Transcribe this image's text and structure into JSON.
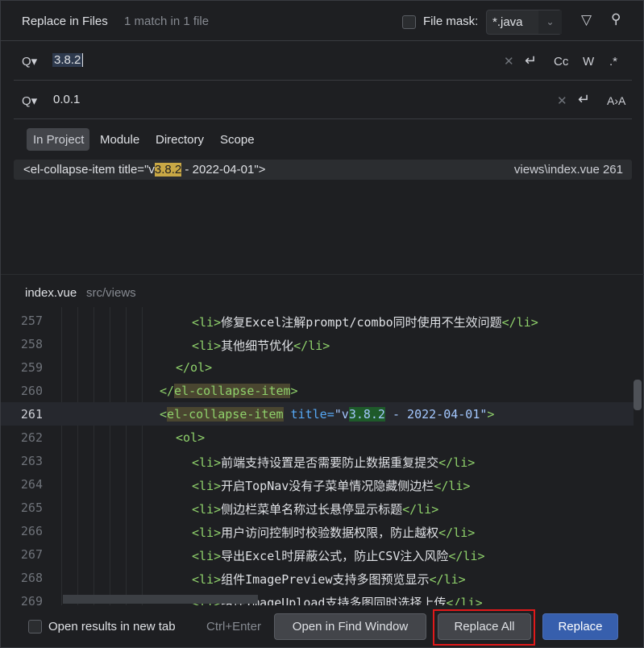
{
  "header": {
    "title": "Replace in Files",
    "match_count": "1 match in 1 file",
    "file_mask_label": "File mask:",
    "file_mask_checked": false,
    "file_mask_value": "*.java"
  },
  "search": {
    "value": "3.8.2",
    "options": {
      "case": "Cc",
      "words": "W",
      "regex": ".*"
    }
  },
  "replace": {
    "value": "0.0.1"
  },
  "scopes": [
    {
      "label": "In Project",
      "active": true
    },
    {
      "label": "Module"
    },
    {
      "label": "Directory"
    },
    {
      "label": "Scope"
    }
  ],
  "result": {
    "prefix": "<el-collapse-item title=\"v",
    "match": "3.8.2",
    "suffix": " - 2022-04-01\">",
    "location": "views\\index.vue 261"
  },
  "preview": {
    "file": "index.vue",
    "path": "src/views",
    "lines": [
      {
        "n": "257",
        "indent": "li",
        "text": "修复Excel注解prompt/combo同时使用不生效问题"
      },
      {
        "n": "258",
        "indent": "li",
        "text": "其他细节优化"
      },
      {
        "n": "259",
        "indent": "ol",
        "text": "</ol>"
      },
      {
        "n": "260",
        "indent": "item",
        "text": "</el-collapse-item>"
      },
      {
        "n": "261",
        "indent": "item",
        "text": ""
      },
      {
        "n": "262",
        "indent": "ol",
        "text": "<ol>"
      },
      {
        "n": "263",
        "indent": "li",
        "text": "前端支持设置是否需要防止数据重复提交"
      },
      {
        "n": "264",
        "indent": "li",
        "text": "开启TopNav没有子菜单情况隐藏侧边栏"
      },
      {
        "n": "265",
        "indent": "li",
        "text": "侧边栏菜单名称过长悬停显示标题"
      },
      {
        "n": "266",
        "indent": "li",
        "text": "用户访问控制时校验数据权限，防止越权"
      },
      {
        "n": "267",
        "indent": "li",
        "text": "导出Excel时屏蔽公式，防止CSV注入风险"
      },
      {
        "n": "268",
        "indent": "li",
        "text": "组件ImagePreview支持多图预览显示"
      },
      {
        "n": "269",
        "indent": "li",
        "text": "组件ImageUpload支持多图同时选择上传"
      }
    ],
    "current": {
      "open": "<",
      "name": "el-collapse-item",
      "attr": " title=",
      "q": "\"v",
      "match": "3.8.2",
      "rest": " - 2022-04-01\"",
      "close": ">"
    }
  },
  "footer": {
    "new_tab_label": "Open results in new tab",
    "new_tab_checked": false,
    "shortcut": "Ctrl+Enter",
    "open_find": "Open in Find Window",
    "replace_all": "Replace All",
    "replace": "Replace"
  },
  "colors": {
    "accent": "#3574f0",
    "match_highlight": "#c9a845",
    "replace_highlight": "#1e5a2a",
    "focus_outline": "#e0191a"
  }
}
